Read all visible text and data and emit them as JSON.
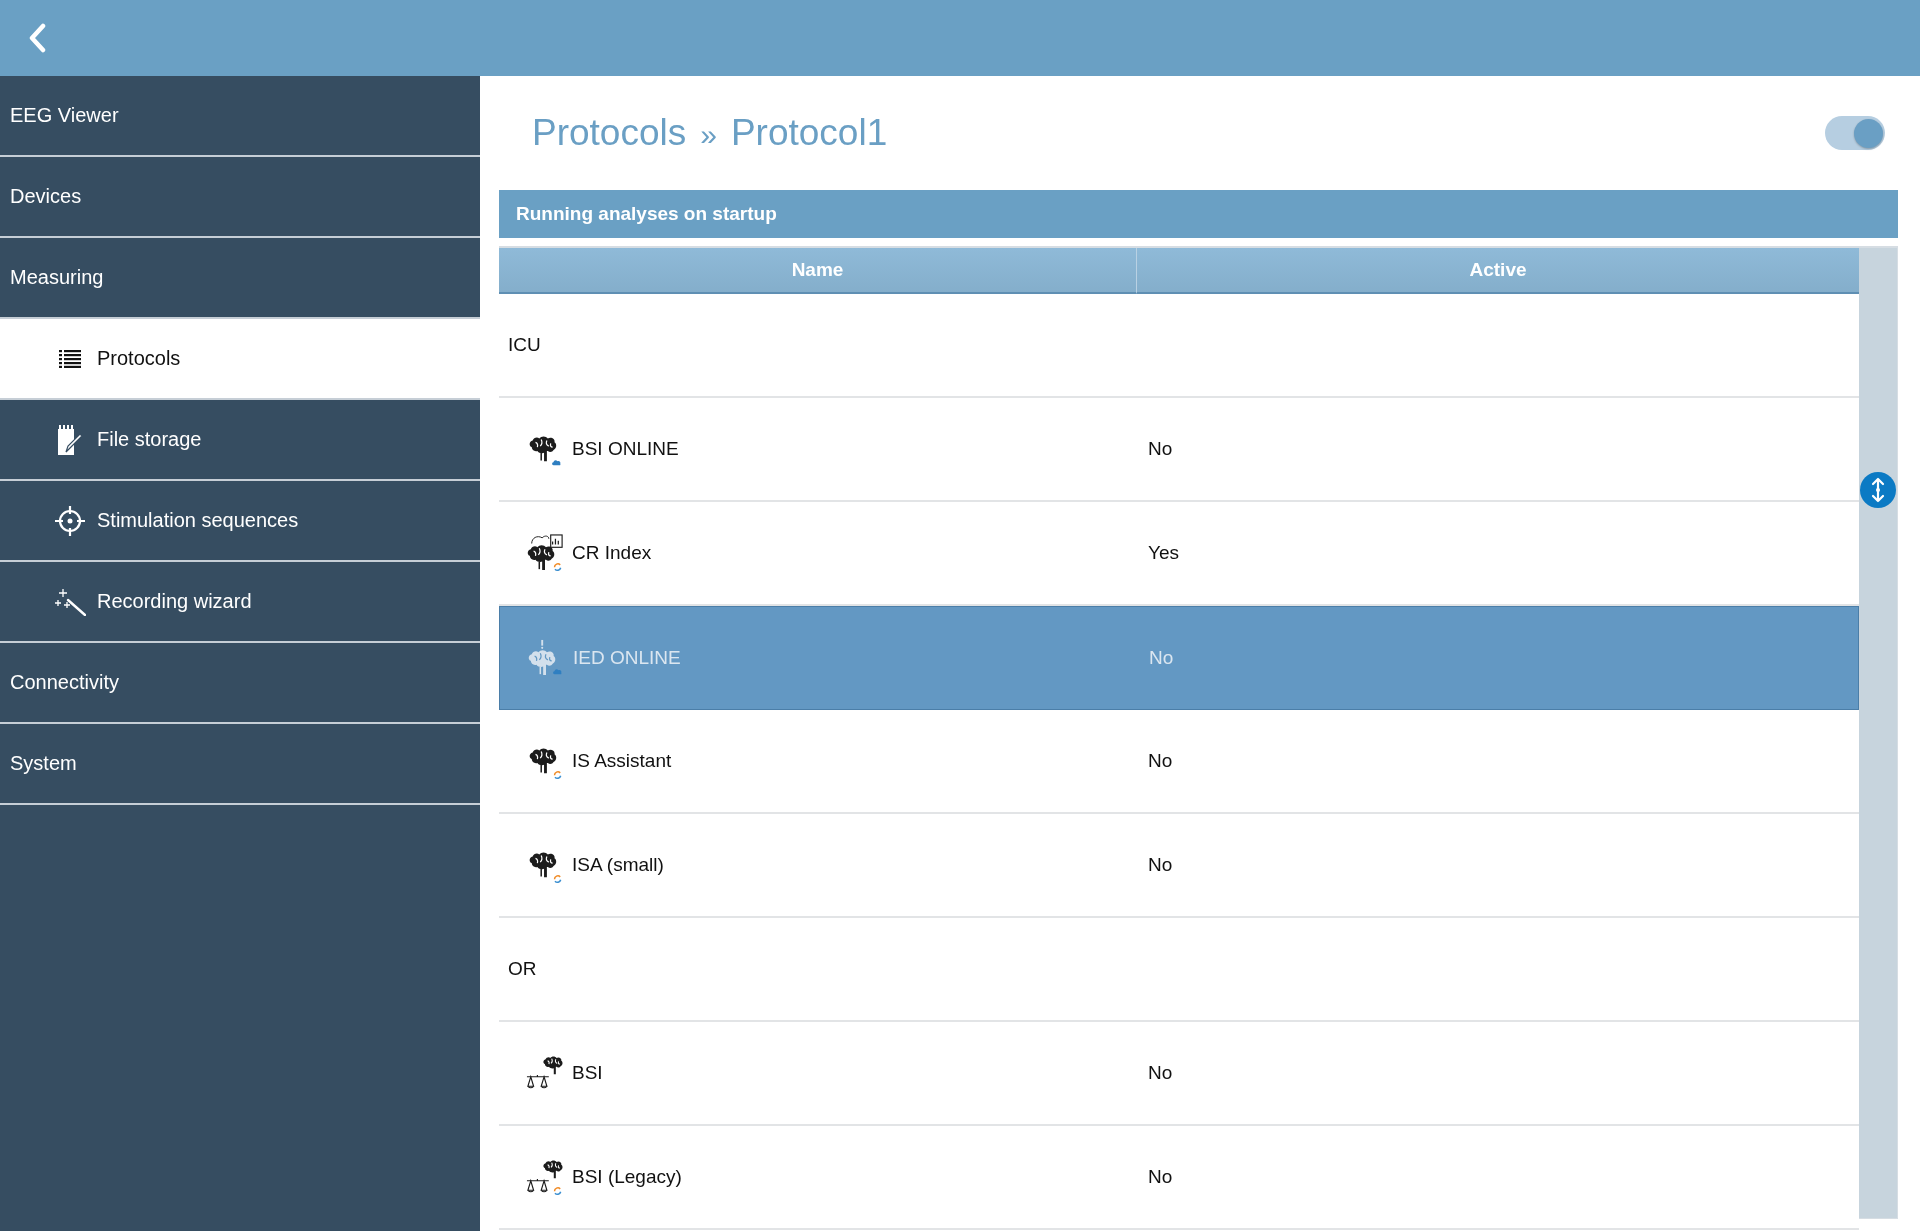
{
  "sidebar": {
    "items": [
      {
        "label": "EEG Viewer",
        "selected": false
      },
      {
        "label": "Devices",
        "selected": false
      },
      {
        "label": "Measuring",
        "selected": false,
        "children": [
          {
            "label": "Protocols",
            "selected": true
          },
          {
            "label": "File storage",
            "selected": false
          },
          {
            "label": "Stimulation sequences",
            "selected": false
          },
          {
            "label": "Recording wizard",
            "selected": false
          }
        ]
      },
      {
        "label": "Connectivity",
        "selected": false
      },
      {
        "label": "System",
        "selected": false
      }
    ]
  },
  "title_bar": {
    "breadcrumb": [
      "Protocols",
      "Protocol1"
    ],
    "separator": "»",
    "toggle": {
      "on": true
    }
  },
  "section": {
    "title": "Running analyses on startup"
  },
  "table": {
    "columns": [
      "Name",
      "Active"
    ],
    "rows": [
      {
        "name": "ICU",
        "selected": false,
        "children": [
          {
            "name": "BSI ONLINE",
            "active": "No",
            "selected": false
          },
          {
            "name": "CR Index",
            "active": "Yes",
            "selected": false
          },
          {
            "name": "IED ONLINE",
            "active": "No",
            "selected": true
          },
          {
            "name": "IS Assistant",
            "active": "No",
            "selected": false
          },
          {
            "name": "ISA (small)",
            "active": "No",
            "selected": false
          }
        ]
      },
      {
        "name": "OR",
        "selected": false,
        "children": [
          {
            "name": "BSI",
            "active": "No",
            "selected": false
          },
          {
            "name": "BSI (Legacy)",
            "active": "No",
            "selected": false
          }
        ]
      }
    ]
  }
}
